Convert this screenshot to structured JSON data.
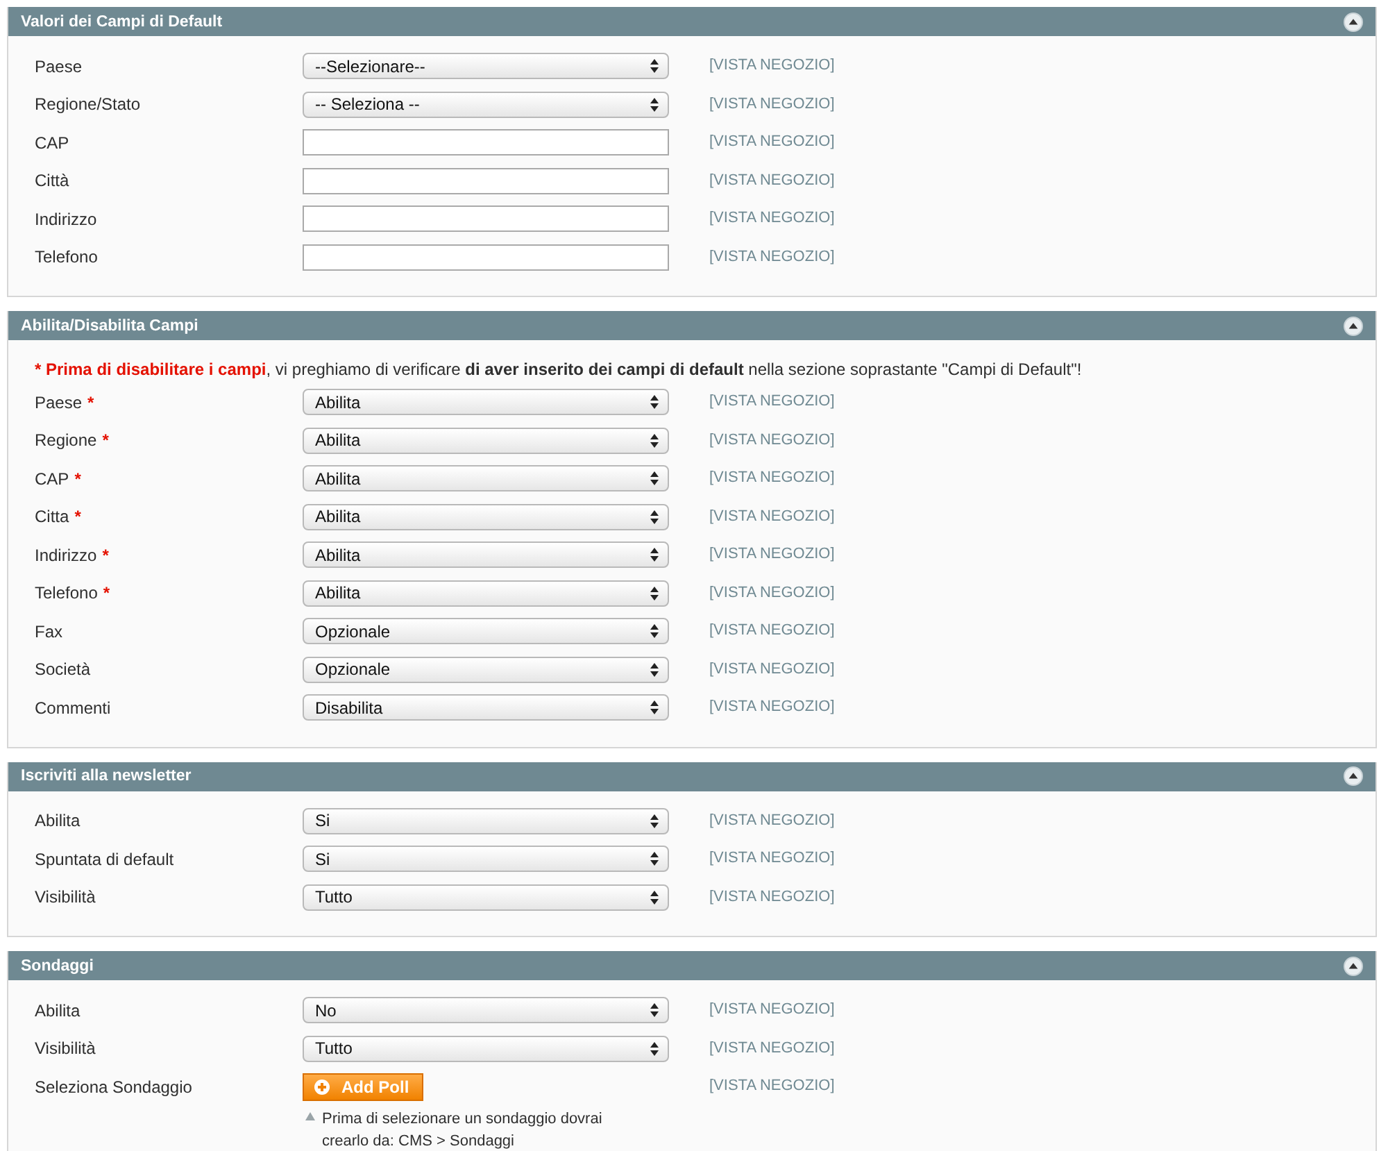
{
  "sections": [
    {
      "title": "Valori dei Campi di Default",
      "expanded": true,
      "rows": [
        {
          "label": "Paese",
          "kind": "select",
          "value": "--Selezionare--",
          "scope": "[VISTA NEGOZIO]"
        },
        {
          "label": "Regione/Stato",
          "kind": "select",
          "value": "-- Seleziona --",
          "scope": "[VISTA NEGOZIO]"
        },
        {
          "label": "CAP",
          "kind": "text",
          "value": "",
          "scope": "[VISTA NEGOZIO]"
        },
        {
          "label": "Città",
          "kind": "text",
          "value": "",
          "scope": "[VISTA NEGOZIO]"
        },
        {
          "label": "Indirizzo",
          "kind": "text",
          "value": "",
          "scope": "[VISTA NEGOZIO]"
        },
        {
          "label": "Telefono",
          "kind": "text",
          "value": "",
          "scope": "[VISTA NEGOZIO]"
        }
      ]
    },
    {
      "title": "Abilita/Disabilita Campi",
      "expanded": true,
      "notice": [
        {
          "text": "* Prima di disabilitare i campi",
          "kind": "alert"
        },
        {
          "text": ", vi preghiamo di verificare ",
          "kind": "plain"
        },
        {
          "text": "di aver inserito dei campi di default",
          "kind": "bold"
        },
        {
          "text": " nella sezione soprastante \"Campi di Default\"!",
          "kind": "plain"
        }
      ],
      "rows": [
        {
          "label": "Paese",
          "required_mark": "*",
          "kind": "select",
          "value": "Abilita",
          "scope": "[VISTA NEGOZIO]"
        },
        {
          "label": "Regione",
          "required_mark": "*",
          "kind": "select",
          "value": "Abilita",
          "scope": "[VISTA NEGOZIO]"
        },
        {
          "label": "CAP",
          "required_mark": "*",
          "kind": "select",
          "value": "Abilita",
          "scope": "[VISTA NEGOZIO]"
        },
        {
          "label": "Citta",
          "required_mark": "*",
          "kind": "select",
          "value": "Abilita",
          "scope": "[VISTA NEGOZIO]"
        },
        {
          "label": "Indirizzo",
          "required_mark": "*",
          "kind": "select",
          "value": "Abilita",
          "scope": "[VISTA NEGOZIO]"
        },
        {
          "label": "Telefono",
          "required_mark": "*",
          "kind": "select",
          "value": "Abilita",
          "scope": "[VISTA NEGOZIO]"
        },
        {
          "label": "Fax",
          "kind": "select",
          "value": "Opzionale",
          "scope": "[VISTA NEGOZIO]"
        },
        {
          "label": "Società",
          "kind": "select",
          "value": "Opzionale",
          "scope": "[VISTA NEGOZIO]"
        },
        {
          "label": "Commenti",
          "kind": "select",
          "value": "Disabilita",
          "scope": "[VISTA NEGOZIO]"
        }
      ]
    },
    {
      "title": "Iscriviti alla newsletter",
      "expanded": true,
      "rows": [
        {
          "label": "Abilita",
          "kind": "select",
          "value": "Si",
          "scope": "[VISTA NEGOZIO]"
        },
        {
          "label": "Spuntata di default",
          "kind": "select",
          "value": "Si",
          "scope": "[VISTA NEGOZIO]"
        },
        {
          "label": "Visibilità",
          "kind": "select",
          "value": "Tutto",
          "scope": "[VISTA NEGOZIO]"
        }
      ]
    },
    {
      "title": "Sondaggi",
      "expanded": true,
      "rows": [
        {
          "label": "Abilita",
          "kind": "select",
          "value": "No",
          "scope": "[VISTA NEGOZIO]"
        },
        {
          "label": "Visibilità",
          "kind": "select",
          "value": "Tutto",
          "scope": "[VISTA NEGOZIO]"
        },
        {
          "label": "Seleziona Sondaggio",
          "kind": "button",
          "value": "Add Poll",
          "scope": "[VISTA NEGOZIO]",
          "hint": "Prima di selezionare un sondaggio dovrai crearlo da: CMS > Sondaggi"
        }
      ]
    }
  ]
}
